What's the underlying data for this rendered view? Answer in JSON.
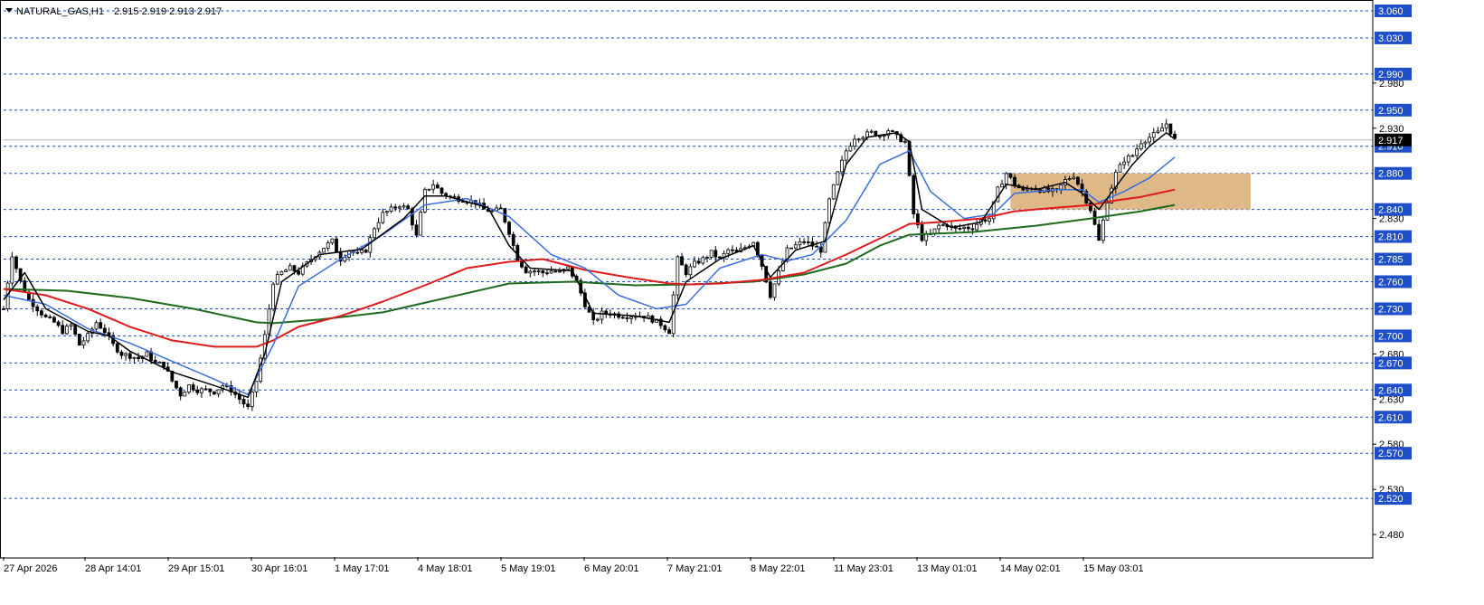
{
  "header": {
    "symbol_label": "NATURAL_GAS,H1",
    "ohlc_label": "2.915 2.919 2.913 2.917"
  },
  "colors": {
    "background": "#ffffff",
    "level_line": "#1f4ec9",
    "level_tag": "#1f4ec9",
    "price_tag": "#000000",
    "ma_fast": "#000000",
    "ma_blue": "#3a6fe0",
    "ma_red": "#e01b1b",
    "ma_green": "#1e6b1e",
    "zone_fill": "#deb887",
    "candle": "#000000"
  },
  "chart_data": {
    "type": "candlestick",
    "symbol": "NATURAL_GAS",
    "timeframe": "H1",
    "current_price": 2.917,
    "ylim": [
      2.455,
      3.068
    ],
    "y_tick_labels": [
      3.06,
      3.03,
      2.99,
      2.98,
      2.95,
      2.93,
      2.91,
      2.88,
      2.84,
      2.83,
      2.81,
      2.785,
      2.76,
      2.73,
      2.7,
      2.68,
      2.67,
      2.64,
      2.63,
      2.61,
      2.58,
      2.57,
      2.53,
      2.52,
      2.48
    ],
    "horizontal_levels": [
      3.06,
      3.03,
      2.99,
      2.95,
      2.91,
      2.88,
      2.84,
      2.81,
      2.785,
      2.76,
      2.73,
      2.7,
      2.67,
      2.64,
      2.61,
      2.57,
      2.52
    ],
    "plain_ticks": [
      2.98,
      2.93,
      2.83,
      2.68,
      2.63,
      2.58,
      2.53,
      2.48
    ],
    "x_labels": [
      "27 Apr 2026",
      "28 Apr 14:01",
      "29 Apr 15:01",
      "30 Apr 16:01",
      "1 May 17:01",
      "4 May 18:01",
      "5 May 19:01",
      "6 May 20:01",
      "7 May 21:01",
      "8 May 22:01",
      "11 May 23:01",
      "13 May 01:01",
      "14 May 02:01",
      "15 May 03:01"
    ],
    "zone": {
      "x_start": 239,
      "x_end": 296,
      "y_top": 2.88,
      "y_bottom": 2.84
    },
    "price_path": [
      [
        0,
        2.73
      ],
      [
        2,
        2.79
      ],
      [
        4,
        2.76
      ],
      [
        6,
        2.74
      ],
      [
        8,
        2.73
      ],
      [
        10,
        2.72
      ],
      [
        12,
        2.715
      ],
      [
        14,
        2.705
      ],
      [
        16,
        2.712
      ],
      [
        18,
        2.69
      ],
      [
        20,
        2.7
      ],
      [
        22,
        2.715
      ],
      [
        24,
        2.705
      ],
      [
        26,
        2.69
      ],
      [
        28,
        2.68
      ],
      [
        30,
        2.678
      ],
      [
        32,
        2.675
      ],
      [
        34,
        2.68
      ],
      [
        36,
        2.67
      ],
      [
        38,
        2.668
      ],
      [
        40,
        2.65
      ],
      [
        42,
        2.635
      ],
      [
        44,
        2.645
      ],
      [
        46,
        2.64
      ],
      [
        48,
        2.64
      ],
      [
        50,
        2.638
      ],
      [
        52,
        2.645
      ],
      [
        54,
        2.64
      ],
      [
        56,
        2.63
      ],
      [
        58,
        2.62
      ],
      [
        60,
        2.65
      ],
      [
        62,
        2.7
      ],
      [
        64,
        2.76
      ],
      [
        66,
        2.77
      ],
      [
        68,
        2.775
      ],
      [
        70,
        2.77
      ],
      [
        72,
        2.78
      ],
      [
        74,
        2.79
      ],
      [
        76,
        2.798
      ],
      [
        78,
        2.805
      ],
      [
        80,
        2.785
      ],
      [
        82,
        2.795
      ],
      [
        84,
        2.79
      ],
      [
        86,
        2.795
      ],
      [
        88,
        2.82
      ],
      [
        90,
        2.835
      ],
      [
        92,
        2.84
      ],
      [
        94,
        2.845
      ],
      [
        96,
        2.84
      ],
      [
        98,
        2.81
      ],
      [
        100,
        2.86
      ],
      [
        102,
        2.868
      ],
      [
        104,
        2.858
      ],
      [
        106,
        2.854
      ],
      [
        108,
        2.852
      ],
      [
        110,
        2.85
      ],
      [
        112,
        2.848
      ],
      [
        114,
        2.84
      ],
      [
        116,
        2.838
      ],
      [
        118,
        2.84
      ],
      [
        120,
        2.815
      ],
      [
        122,
        2.785
      ],
      [
        124,
        2.772
      ],
      [
        126,
        2.772
      ],
      [
        128,
        2.77
      ],
      [
        130,
        2.772
      ],
      [
        132,
        2.77
      ],
      [
        134,
        2.775
      ],
      [
        136,
        2.76
      ],
      [
        138,
        2.735
      ],
      [
        140,
        2.715
      ],
      [
        142,
        2.725
      ],
      [
        144,
        2.725
      ],
      [
        146,
        2.723
      ],
      [
        148,
        2.722
      ],
      [
        150,
        2.723
      ],
      [
        152,
        2.722
      ],
      [
        154,
        2.718
      ],
      [
        156,
        2.713
      ],
      [
        158,
        2.705
      ],
      [
        160,
        2.785
      ],
      [
        162,
        2.77
      ],
      [
        164,
        2.78
      ],
      [
        166,
        2.785
      ],
      [
        168,
        2.792
      ],
      [
        170,
        2.785
      ],
      [
        172,
        2.795
      ],
      [
        174,
        2.792
      ],
      [
        176,
        2.798
      ],
      [
        178,
        2.805
      ],
      [
        180,
        2.778
      ],
      [
        182,
        2.745
      ],
      [
        184,
        2.77
      ],
      [
        186,
        2.795
      ],
      [
        188,
        2.8
      ],
      [
        190,
        2.805
      ],
      [
        192,
        2.8
      ],
      [
        194,
        2.795
      ],
      [
        196,
        2.85
      ],
      [
        198,
        2.88
      ],
      [
        200,
        2.905
      ],
      [
        202,
        2.92
      ],
      [
        204,
        2.922
      ],
      [
        206,
        2.925
      ],
      [
        208,
        2.922
      ],
      [
        210,
        2.928
      ],
      [
        212,
        2.92
      ],
      [
        214,
        2.915
      ],
      [
        216,
        2.835
      ],
      [
        218,
        2.808
      ],
      [
        220,
        2.812
      ],
      [
        222,
        2.822
      ],
      [
        224,
        2.823
      ],
      [
        226,
        2.818
      ],
      [
        228,
        2.82
      ],
      [
        230,
        2.82
      ],
      [
        232,
        2.828
      ],
      [
        234,
        2.83
      ],
      [
        236,
        2.862
      ],
      [
        238,
        2.88
      ],
      [
        240,
        2.868
      ],
      [
        242,
        2.86
      ],
      [
        244,
        2.865
      ],
      [
        246,
        2.862
      ],
      [
        248,
        2.86
      ],
      [
        250,
        2.86
      ],
      [
        252,
        2.872
      ],
      [
        254,
        2.878
      ],
      [
        256,
        2.86
      ],
      [
        258,
        2.84
      ],
      [
        260,
        2.805
      ],
      [
        262,
        2.85
      ],
      [
        264,
        2.88
      ],
      [
        266,
        2.895
      ],
      [
        268,
        2.9
      ],
      [
        270,
        2.915
      ],
      [
        272,
        2.92
      ],
      [
        274,
        2.925
      ],
      [
        276,
        2.935
      ],
      [
        278,
        2.917
      ]
    ],
    "ma_fast_path": [
      [
        0,
        2.74
      ],
      [
        5,
        2.77
      ],
      [
        10,
        2.73
      ],
      [
        20,
        2.705
      ],
      [
        25,
        2.7
      ],
      [
        30,
        2.683
      ],
      [
        40,
        2.66
      ],
      [
        50,
        2.645
      ],
      [
        58,
        2.632
      ],
      [
        62,
        2.68
      ],
      [
        66,
        2.76
      ],
      [
        75,
        2.79
      ],
      [
        85,
        2.796
      ],
      [
        95,
        2.83
      ],
      [
        100,
        2.855
      ],
      [
        105,
        2.855
      ],
      [
        115,
        2.842
      ],
      [
        120,
        2.8
      ],
      [
        125,
        2.775
      ],
      [
        135,
        2.772
      ],
      [
        140,
        2.725
      ],
      [
        150,
        2.722
      ],
      [
        158,
        2.715
      ],
      [
        162,
        2.76
      ],
      [
        170,
        2.785
      ],
      [
        178,
        2.8
      ],
      [
        182,
        2.765
      ],
      [
        188,
        2.795
      ],
      [
        195,
        2.805
      ],
      [
        200,
        2.89
      ],
      [
        205,
        2.92
      ],
      [
        212,
        2.925
      ],
      [
        215,
        2.915
      ],
      [
        218,
        2.84
      ],
      [
        225,
        2.82
      ],
      [
        232,
        2.826
      ],
      [
        238,
        2.868
      ],
      [
        245,
        2.862
      ],
      [
        252,
        2.87
      ],
      [
        256,
        2.858
      ],
      [
        260,
        2.84
      ],
      [
        264,
        2.865
      ],
      [
        268,
        2.89
      ],
      [
        272,
        2.91
      ],
      [
        276,
        2.925
      ],
      [
        278,
        2.918
      ]
    ],
    "ma_blue_path": [
      [
        0,
        2.745
      ],
      [
        10,
        2.735
      ],
      [
        20,
        2.708
      ],
      [
        30,
        2.692
      ],
      [
        40,
        2.672
      ],
      [
        50,
        2.652
      ],
      [
        58,
        2.635
      ],
      [
        64,
        2.69
      ],
      [
        70,
        2.755
      ],
      [
        80,
        2.785
      ],
      [
        90,
        2.812
      ],
      [
        100,
        2.845
      ],
      [
        110,
        2.852
      ],
      [
        120,
        2.832
      ],
      [
        130,
        2.79
      ],
      [
        138,
        2.775
      ],
      [
        146,
        2.745
      ],
      [
        155,
        2.73
      ],
      [
        162,
        2.735
      ],
      [
        170,
        2.775
      ],
      [
        180,
        2.79
      ],
      [
        186,
        2.783
      ],
      [
        192,
        2.79
      ],
      [
        200,
        2.828
      ],
      [
        208,
        2.89
      ],
      [
        215,
        2.905
      ],
      [
        220,
        2.86
      ],
      [
        228,
        2.83
      ],
      [
        235,
        2.835
      ],
      [
        240,
        2.858
      ],
      [
        250,
        2.862
      ],
      [
        256,
        2.862
      ],
      [
        260,
        2.848
      ],
      [
        266,
        2.86
      ],
      [
        272,
        2.875
      ],
      [
        278,
        2.898
      ]
    ],
    "ma_red_path": [
      [
        0,
        2.752
      ],
      [
        10,
        2.745
      ],
      [
        20,
        2.73
      ],
      [
        30,
        2.71
      ],
      [
        40,
        2.695
      ],
      [
        50,
        2.688
      ],
      [
        60,
        2.688
      ],
      [
        64,
        2.695
      ],
      [
        70,
        2.71
      ],
      [
        80,
        2.722
      ],
      [
        90,
        2.738
      ],
      [
        100,
        2.756
      ],
      [
        110,
        2.775
      ],
      [
        120,
        2.782
      ],
      [
        128,
        2.785
      ],
      [
        138,
        2.773
      ],
      [
        148,
        2.765
      ],
      [
        158,
        2.758
      ],
      [
        163,
        2.757
      ],
      [
        170,
        2.758
      ],
      [
        180,
        2.762
      ],
      [
        190,
        2.77
      ],
      [
        200,
        2.79
      ],
      [
        208,
        2.808
      ],
      [
        215,
        2.824
      ],
      [
        222,
        2.826
      ],
      [
        232,
        2.83
      ],
      [
        240,
        2.838
      ],
      [
        250,
        2.842
      ],
      [
        258,
        2.845
      ],
      [
        264,
        2.85
      ],
      [
        270,
        2.854
      ],
      [
        278,
        2.862
      ]
    ],
    "ma_green_path": [
      [
        0,
        2.752
      ],
      [
        15,
        2.75
      ],
      [
        30,
        2.742
      ],
      [
        45,
        2.73
      ],
      [
        60,
        2.715
      ],
      [
        64,
        2.714
      ],
      [
        75,
        2.718
      ],
      [
        90,
        2.726
      ],
      [
        105,
        2.742
      ],
      [
        120,
        2.758
      ],
      [
        135,
        2.76
      ],
      [
        150,
        2.756
      ],
      [
        163,
        2.757
      ],
      [
        178,
        2.76
      ],
      [
        190,
        2.768
      ],
      [
        200,
        2.78
      ],
      [
        208,
        2.8
      ],
      [
        215,
        2.812
      ],
      [
        230,
        2.815
      ],
      [
        245,
        2.822
      ],
      [
        258,
        2.83
      ],
      [
        270,
        2.838
      ],
      [
        278,
        2.845
      ]
    ]
  }
}
